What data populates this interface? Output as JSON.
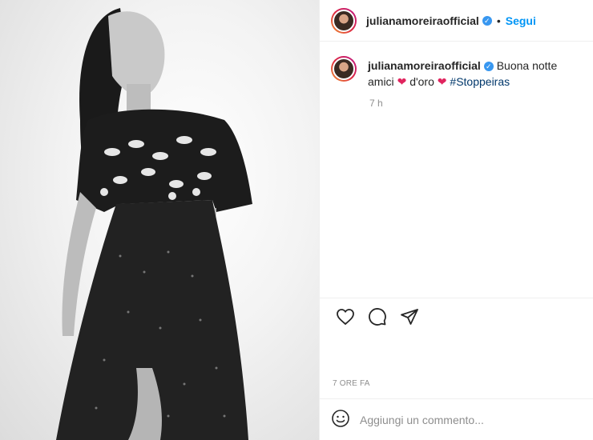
{
  "post": {
    "username": "julianamoreiraofficial",
    "follow_label": "Segui",
    "separator": "•",
    "caption_text": "Buona notte amici",
    "caption_text_2": "d'oro",
    "heart": "❤",
    "hashtag": "#Stoppeiras",
    "caption_time": "7 h",
    "timestamp": "7 ORE FA",
    "comment_placeholder": "Aggiungi un commento..."
  },
  "icons": {
    "verified": "verified-badge",
    "like": "heart-icon",
    "comment": "comment-icon",
    "share": "share-icon",
    "emoji": "emoji-icon"
  },
  "colors": {
    "accent": "#0095f6",
    "verified": "#3897f0",
    "heart": "#e0245e",
    "hashtag": "#00376b",
    "muted": "#8e8e8e"
  }
}
